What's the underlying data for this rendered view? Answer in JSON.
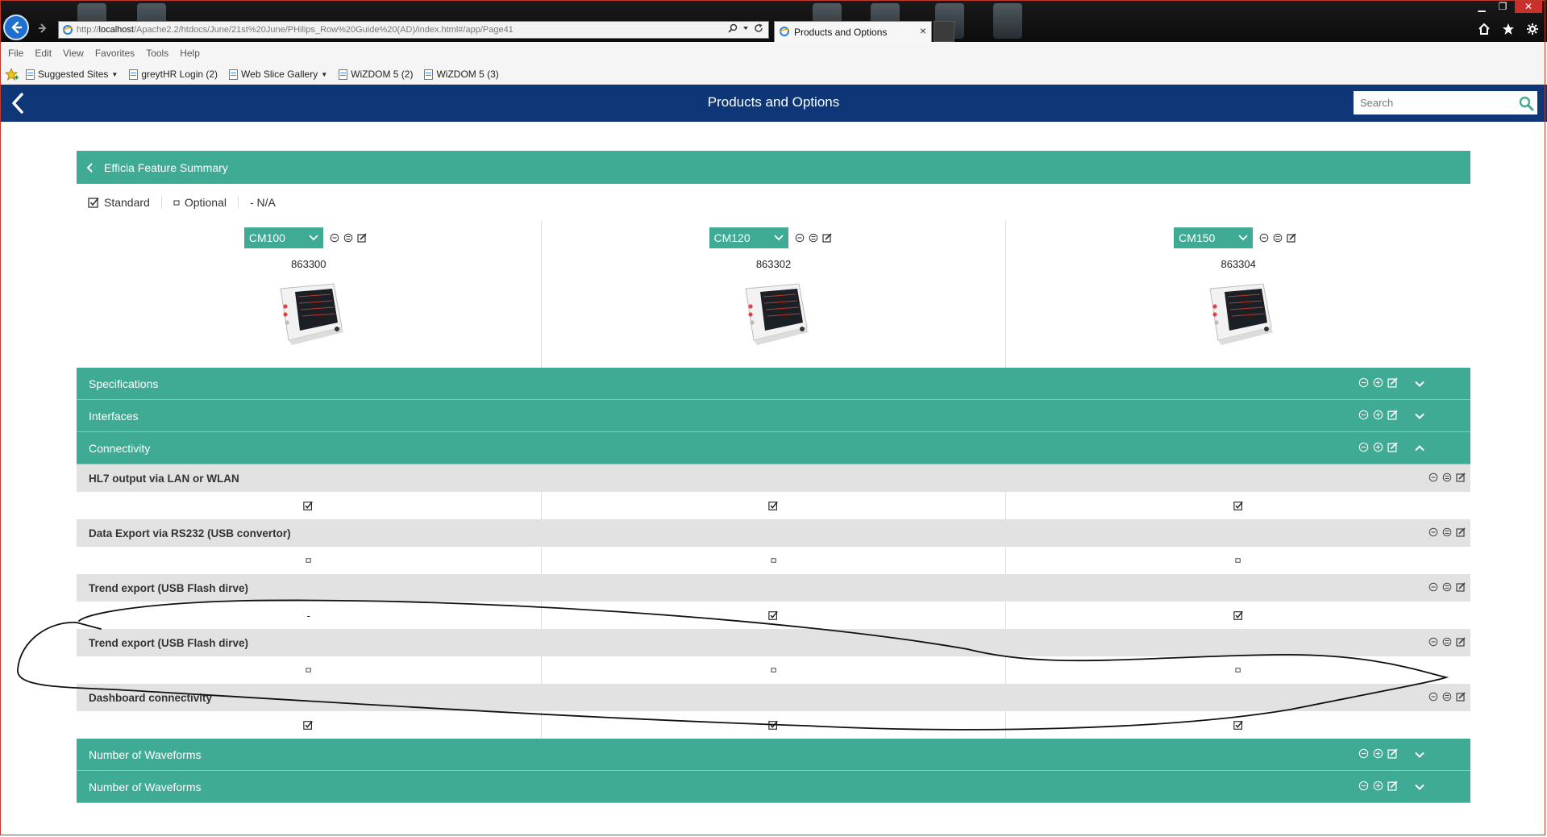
{
  "browser": {
    "address": {
      "prefix": "http://",
      "host": "localhost",
      "path": "/Apache2.2/htdocs/June/21st%20June/PHilips_Row%20Guide%20(AD)/index.html#/app/Page41"
    },
    "tab_title": "Products and Options",
    "menu": [
      "File",
      "Edit",
      "View",
      "Favorites",
      "Tools",
      "Help"
    ],
    "favorites": [
      "Suggested Sites",
      "greytHR Login (2)",
      "Web Slice Gallery",
      "WiZDOM 5 (2)",
      "WiZDOM 5 (3)"
    ]
  },
  "app": {
    "title": "Products and Options",
    "search_placeholder": "Search"
  },
  "summary": {
    "title": "Efficia Feature Summary"
  },
  "legend": {
    "standard": "Standard",
    "optional": "Optional",
    "na": "- N/A"
  },
  "products": [
    {
      "model": "CM100",
      "number": "863300"
    },
    {
      "model": "CM120",
      "number": "863302"
    },
    {
      "model": "CM150",
      "number": "863304"
    }
  ],
  "sections": {
    "specifications": "Specifications",
    "interfaces": "Interfaces",
    "connectivity": "Connectivity",
    "waveforms_1": "Number of Waveforms",
    "waveforms_2": "Number of Waveforms"
  },
  "features": [
    {
      "name": "HL7 output via LAN or WLAN",
      "values": [
        "standard",
        "standard",
        "standard"
      ]
    },
    {
      "name": "Data Export via RS232 (USB convertor)",
      "values": [
        "optional",
        "optional",
        "optional"
      ]
    },
    {
      "name": "Trend export (USB Flash dirve)",
      "values": [
        "na",
        "standard",
        "standard"
      ]
    },
    {
      "name": "Trend export (USB Flash dirve)",
      "values": [
        "optional",
        "optional",
        "optional"
      ]
    },
    {
      "name": "Dashboard connectivity",
      "values": [
        "standard",
        "standard",
        "standard"
      ]
    }
  ],
  "na_mark": "-",
  "colors": {
    "app_header": "#0f3677",
    "teal": "#3fab94",
    "feature_header": "#e2e2e2"
  }
}
